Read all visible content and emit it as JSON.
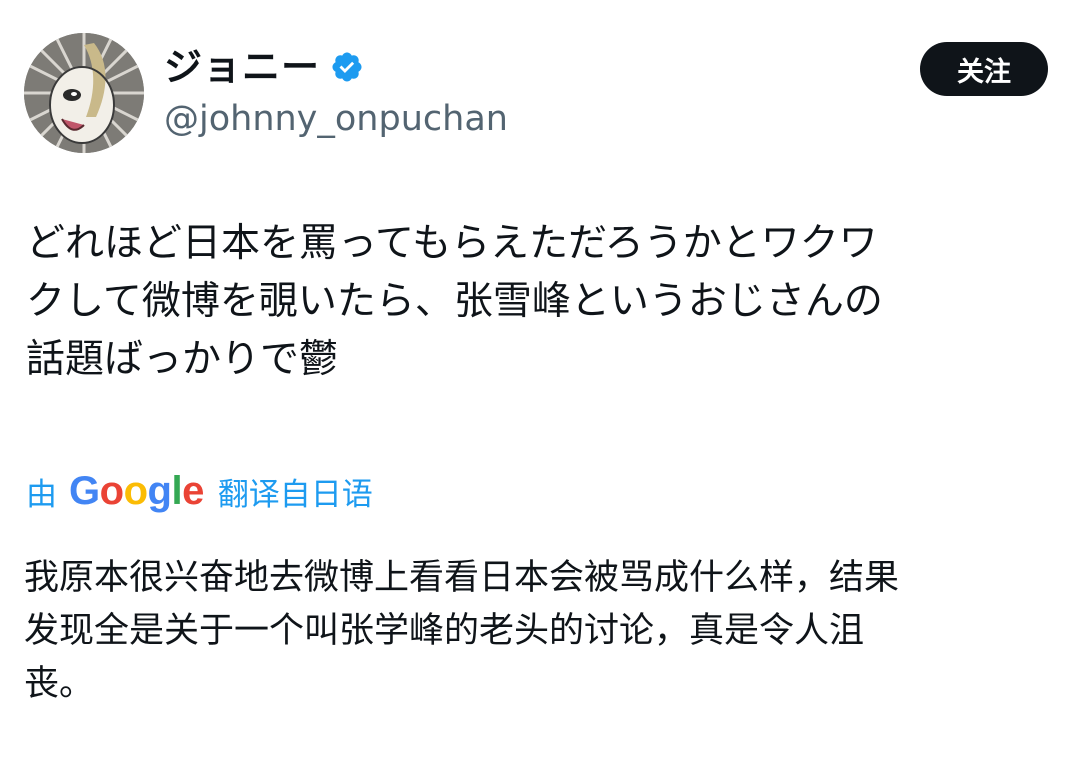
{
  "profile": {
    "display_name": "ジョニー",
    "handle": "@johnny_onpuchan",
    "verified_icon": "verified-badge-icon",
    "avatar_icon": "avatar-image"
  },
  "follow_button": {
    "label": "关注"
  },
  "tweet": {
    "text": "どれほど日本を罵ってもらえただろうかとワクワ\nクして微博を覗いたら、张雪峰というおじさんの\n話題ばっかりで鬱"
  },
  "translation": {
    "by": "由",
    "logo": {
      "l1": "G",
      "l2": "o",
      "l3": "o",
      "l4": "g",
      "l5": "l",
      "l6": "e"
    },
    "suffix": "翻译自日语",
    "text": "我原本很兴奋地去微博上看看日本会被骂成什么样，结果\n发现全是关于一个叫张学峰的老头的讨论，真是令人沮\n丧。"
  },
  "colors": {
    "link_blue": "#1d9bf0",
    "handle_gray": "#536471",
    "text": "#0f1419",
    "button_bg": "#0f1419",
    "google_blue": "#4285f4",
    "google_red": "#ea4335",
    "google_yellow": "#fbbc05",
    "google_green": "#34a853"
  }
}
